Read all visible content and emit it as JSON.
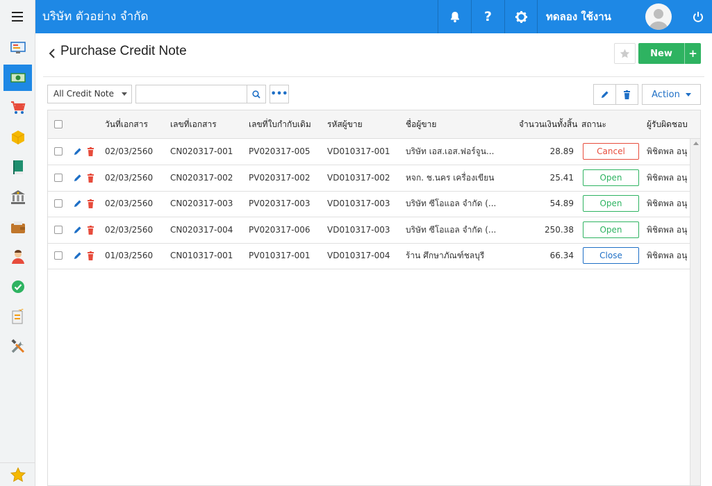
{
  "app": {
    "company_name": "บริษัท ตัวอย่าง จำกัด",
    "user_name": "ทดลอง ใช้งาน",
    "accent": "#1e88e5"
  },
  "topbar_icons": [
    "bell-icon",
    "help-icon",
    "gear-icon",
    "power-icon"
  ],
  "sidebar": {
    "items": [
      {
        "name": "dashboard-icon"
      },
      {
        "name": "money-icon",
        "active": true
      },
      {
        "name": "cart-icon"
      },
      {
        "name": "box-icon"
      },
      {
        "name": "book-icon"
      },
      {
        "name": "bank-icon"
      },
      {
        "name": "wallet-icon"
      },
      {
        "name": "people-icon"
      },
      {
        "name": "check-icon"
      },
      {
        "name": "transfer-icon"
      },
      {
        "name": "tools-icon"
      }
    ],
    "favorite": "star-icon"
  },
  "header": {
    "title": "Purchase Credit Note",
    "new_label": "New",
    "plus_label": "+"
  },
  "toolbar": {
    "filter_value": "All Credit Note",
    "search_placeholder": "",
    "more_label": "•••",
    "action_label": "Action"
  },
  "table": {
    "columns": [
      "วันที่เอกสาร",
      "เลขที่เอกสาร",
      "เลขที่ใบกำกับเดิม",
      "รหัสผู้ขาย",
      "ชื่อผู้ขาย",
      "จำนวนเงินทั้งสิ้น",
      "สถานะ",
      "ผู้รับผิดชอบ"
    ],
    "rows": [
      {
        "date": "02/03/2560",
        "doc_no": "CN020317-001",
        "ref_no": "PV020317-005",
        "vendor_code": "VD010317-001",
        "vendor_name": "บริษัท เอส.เอส.ฟอร์จูน...",
        "amount": "28.89",
        "status": "Cancel",
        "owner": "พิชิตพล อนุ"
      },
      {
        "date": "02/03/2560",
        "doc_no": "CN020317-002",
        "ref_no": "PV020317-002",
        "vendor_code": "VD010317-002",
        "vendor_name": "หจก. ช.นคร เครื่องเขียน",
        "amount": "25.41",
        "status": "Open",
        "owner": "พิชิตพล อนุ"
      },
      {
        "date": "02/03/2560",
        "doc_no": "CN020317-003",
        "ref_no": "PV020317-003",
        "vendor_code": "VD010317-003",
        "vendor_name": "บริษัท ซีโอแอล จำกัด (...",
        "amount": "54.89",
        "status": "Open",
        "owner": "พิชิตพล อนุ"
      },
      {
        "date": "02/03/2560",
        "doc_no": "CN020317-004",
        "ref_no": "PV020317-006",
        "vendor_code": "VD010317-003",
        "vendor_name": "บริษัท ซีโอแอล จำกัด (...",
        "amount": "250.38",
        "status": "Open",
        "owner": "พิชิตพล อนุ"
      },
      {
        "date": "01/03/2560",
        "doc_no": "CN010317-001",
        "ref_no": "PV010317-001",
        "vendor_code": "VD010317-004",
        "vendor_name": "ร้าน ศึกษาภัณฑ์ชลบุรี",
        "amount": "66.34",
        "status": "Close",
        "owner": "พิชิตพล อนุ"
      }
    ],
    "status_colors": {
      "Cancel": "#e74c3c",
      "Open": "#2eb361",
      "Close": "#1e6fc6"
    }
  }
}
